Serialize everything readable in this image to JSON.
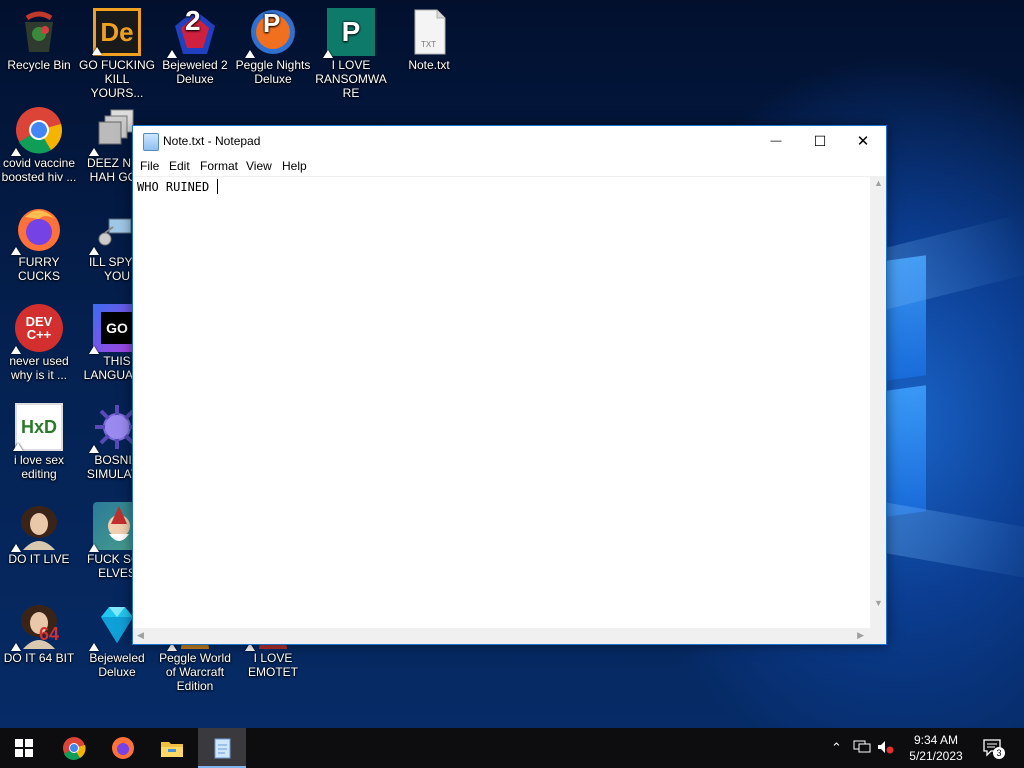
{
  "desktop": {
    "icons": [
      {
        "label": "Recycle Bin",
        "icon": "recycle-bin-icon"
      },
      {
        "label": "GO FUCKING KILL YOURS...",
        "icon": "dexpot-de-icon"
      },
      {
        "label": "Bejeweled 2 Deluxe",
        "icon": "bejeweled-2-icon"
      },
      {
        "label": "Peggle Nights Deluxe",
        "icon": "peggle-icon"
      },
      {
        "label": "I LOVE RANSOMWARE",
        "icon": "publisher-icon"
      },
      {
        "label": "Note.txt",
        "icon": "txt-file-icon"
      },
      {
        "label": "covid vaccine boosted hiv ...",
        "icon": "chrome-icon"
      },
      {
        "label": "DEEZ NUT HAH GOT",
        "icon": "stacked-windows-icon"
      },
      {
        "label": "FURRY CUCKS",
        "icon": "firefox-icon"
      },
      {
        "label": "ILL SPY O YOU",
        "icon": "network-spy-icon"
      },
      {
        "label": "never used why is it ...",
        "icon": "devcpp-icon"
      },
      {
        "label": "THIS LANGUAGE",
        "icon": "goland-icon"
      },
      {
        "label": "i love sex editing",
        "icon": "hxd-icon"
      },
      {
        "label": "BOSNIA SIMULATO",
        "icon": "spiky-ball-icon"
      },
      {
        "label": "DO IT LIVE",
        "icon": "portrait-icon"
      },
      {
        "label": "FUCK SOL ELVES",
        "icon": "solitaire-elves-icon"
      },
      {
        "label": "DO IT 64 BIT",
        "icon": "portrait-64-icon"
      },
      {
        "label": "Bejeweled Deluxe",
        "icon": "diamond-icon"
      },
      {
        "label": "Peggle World of Warcraft Edition",
        "icon": "peggle-wow-icon"
      },
      {
        "label": "I LOVE EMOTET",
        "icon": "emotet-icon"
      }
    ],
    "devcpp_icon_text": "DEV C++",
    "goland_icon_text": "GO",
    "hxd_icon_text": "HxD",
    "txt_icon_text": "TXT",
    "de_icon_text": "De",
    "sixtyfour_text": "64",
    "bejeweled2_text": "2",
    "peggle_text": "P",
    "publisher_text": "P"
  },
  "notepad": {
    "title": "Note.txt - Notepad",
    "menu": [
      "File",
      "Edit",
      "Format",
      "View",
      "Help"
    ],
    "content": "WHO RUINED ",
    "minimize_glyph": "—",
    "maximize_glyph": "☐",
    "close_glyph": "✕"
  },
  "taskbar": {
    "time": "9:34 AM",
    "date": "5/21/2023",
    "notification_count": "3",
    "apps": [
      "start-icon",
      "chrome-icon",
      "firefox-icon",
      "file-explorer-icon",
      "notepad-icon"
    ]
  },
  "colors": {
    "accent": "#1a73c9",
    "taskbar": "#0d0d10",
    "wallpaper": "#062b66"
  }
}
